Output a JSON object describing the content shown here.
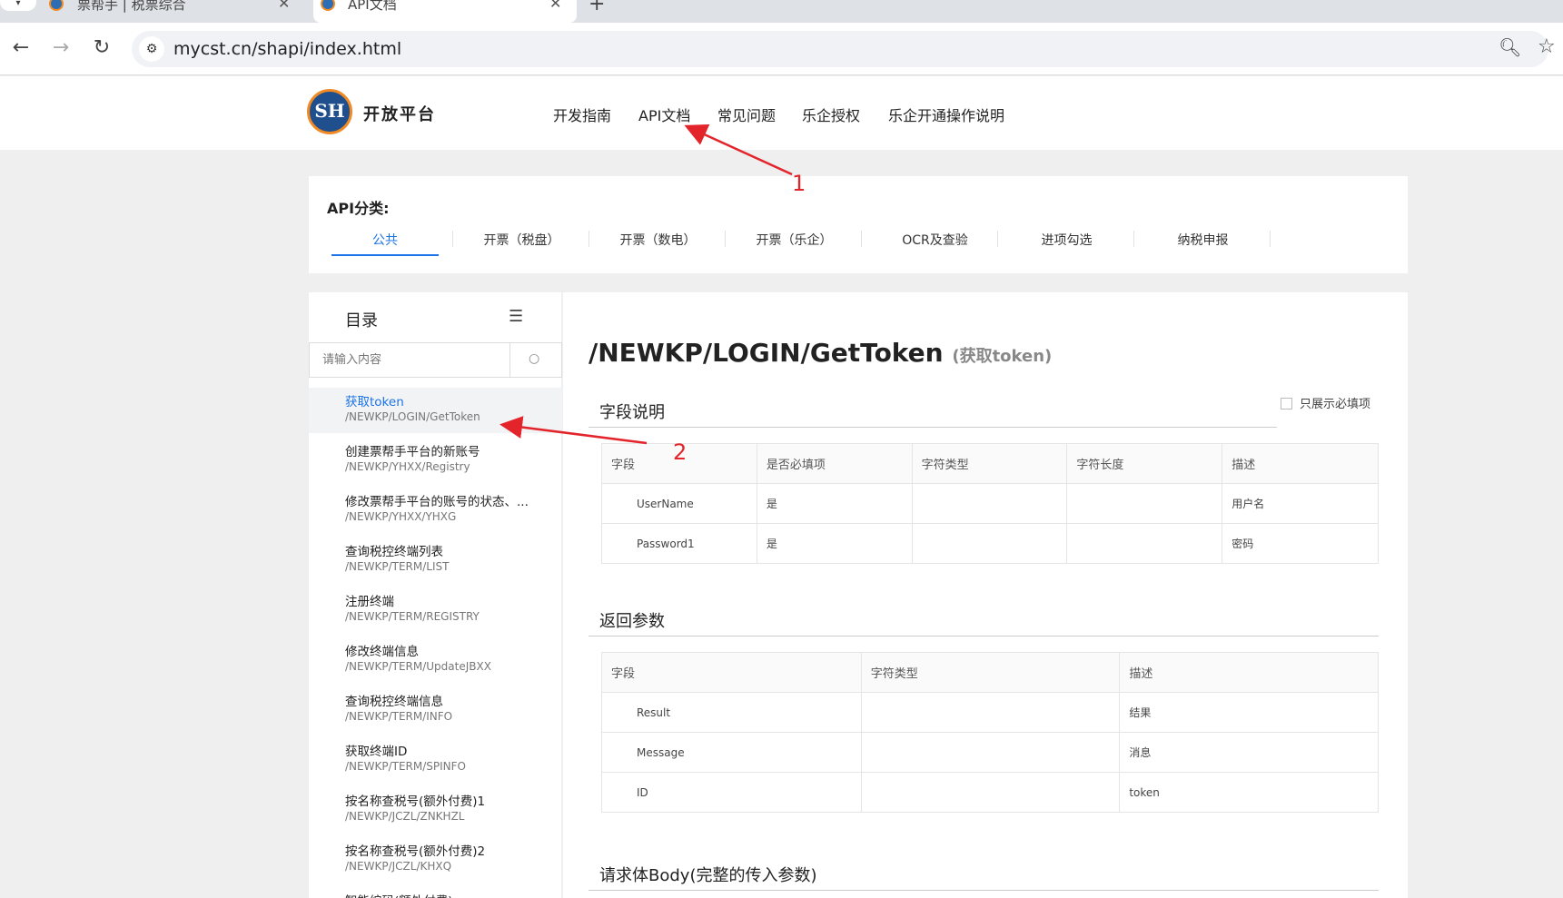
{
  "browser": {
    "tabs": [
      {
        "title": "票帮手 | 税票综合"
      },
      {
        "title": "API文档"
      }
    ],
    "new_tab": "+",
    "url": "mycst.cn/shapi/index.html"
  },
  "header": {
    "logo_text": "SH",
    "brand": "开放平台",
    "nav": [
      "开发指南",
      "API文档",
      "常见问题",
      "乐企授权",
      "乐企开通操作说明"
    ]
  },
  "categories": {
    "title": "API分类:",
    "tabs": [
      "公共",
      "开票（税盘）",
      "开票（数电）",
      "开票（乐企）",
      "OCR及查验",
      "进项勾选",
      "纳税申报"
    ]
  },
  "sidebar": {
    "title": "目录",
    "search_placeholder": "请输入内容",
    "items": [
      {
        "name": "获取token",
        "path": "/NEWKP/LOGIN/GetToken"
      },
      {
        "name": "创建票帮手平台的新账号",
        "path": "/NEWKP/YHXX/Registry"
      },
      {
        "name": "修改票帮手平台的账号的状态、...",
        "path": "/NEWKP/YHXX/YHXG"
      },
      {
        "name": "查询税控终端列表",
        "path": "/NEWKP/TERM/LIST"
      },
      {
        "name": "注册终端",
        "path": "/NEWKP/TERM/REGISTRY"
      },
      {
        "name": "修改终端信息",
        "path": "/NEWKP/TERM/UpdateJBXX"
      },
      {
        "name": "查询税控终端信息",
        "path": "/NEWKP/TERM/INFO"
      },
      {
        "name": "获取终端ID",
        "path": "/NEWKP/TERM/SPINFO"
      },
      {
        "name": "按名称查税号(额外付费)1",
        "path": "/NEWKP/JCZL/ZNKHZL"
      },
      {
        "name": "按名称查税号(额外付费)2",
        "path": "/NEWKP/JCZL/KHXQ"
      },
      {
        "name": "智能编码(额外付费)",
        "path": ""
      }
    ]
  },
  "main": {
    "api_path": "/NEWKP/LOGIN/GetToken",
    "api_name": "(获取token)",
    "fields_title": "字段说明",
    "required_only": "只展示必填项",
    "fields_headers": [
      "字段",
      "是否必填项",
      "字符类型",
      "字符长度",
      "描述"
    ],
    "fields_rows": [
      [
        "UserName",
        "是",
        "",
        "",
        "用户名"
      ],
      [
        "Password1",
        "是",
        "",
        "",
        "密码"
      ]
    ],
    "return_title": "返回参数",
    "return_headers": [
      "字段",
      "字符类型",
      "描述"
    ],
    "return_rows": [
      [
        "Result",
        "",
        "结果"
      ],
      [
        "Message",
        "",
        "消息"
      ],
      [
        "ID",
        "",
        "token"
      ]
    ],
    "body_title": "请求体Body(完整的传入参数)"
  },
  "annotations": [
    "1",
    "2"
  ],
  "colors": {
    "accent": "#1a73e8",
    "annotation": "#e3242b",
    "logo_ring": "#f08a24"
  }
}
